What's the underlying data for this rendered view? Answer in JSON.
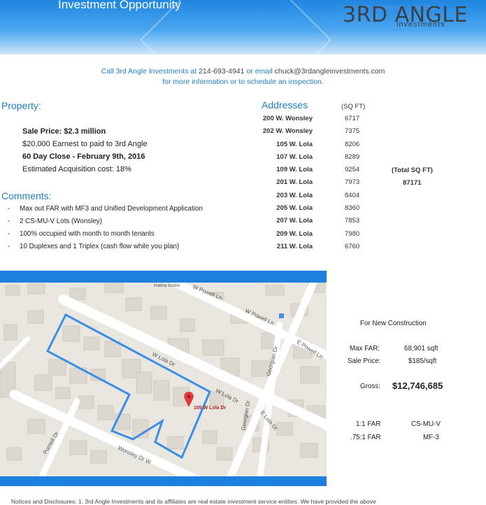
{
  "header": {
    "title": "Investment Opportunity",
    "logo_main": "3RD ANGLE",
    "logo_sub": "investments"
  },
  "contact": {
    "call_prefix": "Call 3rd Angle Investments at",
    "phone": "214-693-4941",
    "or_email": "or email",
    "email": "chuck@3rdangleinvestments.com",
    "line2": "for more information or to schedule an inspection."
  },
  "property": {
    "heading": "Property:",
    "lines": [
      "Sale Price: $2.3 million",
      "$20,000 Earnest to paid to 3rd Angle",
      "60 Day Close - February 9th, 2016",
      "Estimated Acquisition cost: 18%"
    ]
  },
  "addresses": {
    "heading": "Addresses",
    "sqft_heading": "(SQ FT)",
    "rows": [
      {
        "address": "200 W. Wonsley",
        "sqft": "6717"
      },
      {
        "address": "202 W. Wonsley",
        "sqft": "7375"
      },
      {
        "address": "105 W. Lola",
        "sqft": "8206"
      },
      {
        "address": "107 W. Lola",
        "sqft": "8289"
      },
      {
        "address": "109 W. Lola",
        "sqft": "9254"
      },
      {
        "address": "201 W. Lola",
        "sqft": "7973"
      },
      {
        "address": "203 W. Lola",
        "sqft": "8404"
      },
      {
        "address": "205 W. Lola",
        "sqft": "8360"
      },
      {
        "address": "207 W. Lola",
        "sqft": "7853"
      },
      {
        "address": "209 W. Lola",
        "sqft": "7980"
      },
      {
        "address": "211 W. Lola",
        "sqft": "6760"
      }
    ],
    "total_label": "(Total SQ FT)",
    "total_value": "87171"
  },
  "comments": {
    "heading": "Comments:",
    "bullet": "-",
    "items": [
      "Max out FAR with MF3 and Unified Development Application",
      "2 CS-MU-V Lots (Wonsley)",
      "100% occupied with month to month tenants",
      "10 Duplexes and 1 Triplex (cash flow while you plan)"
    ]
  },
  "map": {
    "marker_label": "105 W Lola Dr",
    "streets": {
      "w_powell_1": "W Powell Ln",
      "w_powell_2": "W Powell Ln",
      "e_powell": "E Powell Ln",
      "w_lola_1": "W Lola Dr",
      "w_lola_2": "W Lola Dr",
      "e_lola": "E Lola Dr",
      "georgian_1": "Georgian Dr",
      "georgian_2": "Georgian Dr",
      "purnell": "Purnell Dr",
      "wonsley": "Wonsley Dr W",
      "halina": "Halina Andre"
    },
    "boundary_color": "#3a8ee6",
    "marker_color": "#e0383a"
  },
  "construction": {
    "heading": "For New Construction",
    "max_far_label": "Max FAR:",
    "max_far_value": "68,901 sqft",
    "sale_price_label": "Sale Price:",
    "sale_price_value": "$185/sqft",
    "gross_label": "Gross:",
    "gross_value": "$12,746,685",
    "far_rows": [
      {
        "ratio": "1:1 FAR",
        "zone": "CS-MU-V"
      },
      {
        "ratio": ".75:1 FAR",
        "zone": "MF-3"
      }
    ]
  },
  "footer": {
    "text": "Notices and Disclosures: 1. 3rd Angle Investments and its affiliates are real estate investment service entities. We have provided the above"
  }
}
